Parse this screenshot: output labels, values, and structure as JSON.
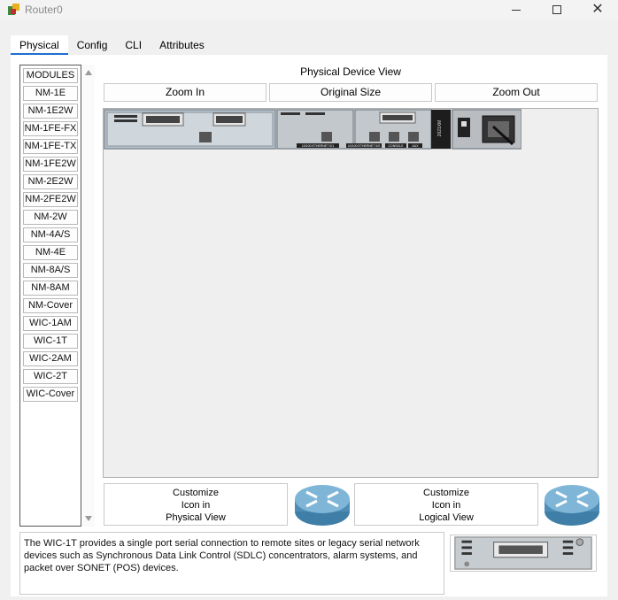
{
  "window": {
    "title": "Router0",
    "icon": "router-app-icon"
  },
  "tabs": [
    {
      "label": "Physical",
      "active": true
    },
    {
      "label": "Config",
      "active": false
    },
    {
      "label": "CLI",
      "active": false
    },
    {
      "label": "Attributes",
      "active": false
    }
  ],
  "modules": [
    "MODULES",
    "NM-1E",
    "NM-1E2W",
    "NM-1FE-FX",
    "NM-1FE-TX",
    "NM-1FE2W",
    "NM-2E2W",
    "NM-2FE2W",
    "NM-2W",
    "NM-4A/S",
    "NM-4E",
    "NM-8A/S",
    "NM-8AM",
    "NM-Cover",
    "WIC-1AM",
    "WIC-1T",
    "WIC-2AM",
    "WIC-2T",
    "WIC-Cover"
  ],
  "device_view": {
    "title": "Physical Device View",
    "zoom_in": "Zoom In",
    "original_size": "Original Size",
    "zoom_out": "Zoom Out"
  },
  "chassis_labels": {
    "model": "2621XM",
    "eth0": "10/100 ETHERNET 0/1",
    "eth1": "10/100 ETHERNET 0/0",
    "console": "CONSOLE",
    "aux": "AUX"
  },
  "customize": {
    "physical": [
      "Customize",
      "Icon in",
      "Physical View"
    ],
    "logical": [
      "Customize",
      "Icon in",
      "Logical View"
    ]
  },
  "description": "The WIC-1T provides a single port serial connection to remote sites or legacy serial network devices such as Synchronous Data Link Control (SDLC) concentrators, alarm systems, and packet over SONET (POS) devices.",
  "colors": {
    "active_tab_underline": "#1f6fd1",
    "router_icon": "#5a9fc4"
  }
}
